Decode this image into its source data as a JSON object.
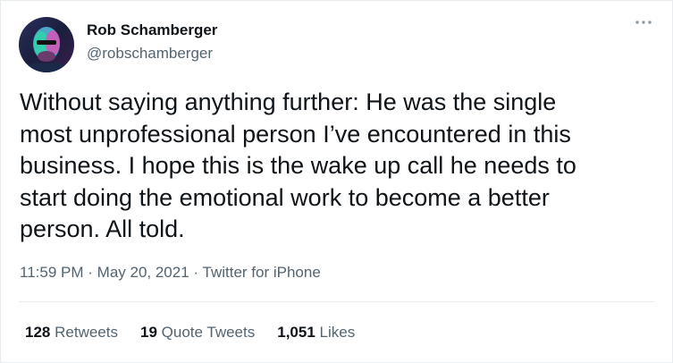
{
  "author": {
    "name": "Rob Schamberger",
    "handle": "@robschamberger"
  },
  "icons": {
    "avatar": "user-avatar",
    "more": "more-options-icon"
  },
  "tweet": {
    "text": "Without saying anything further: He was the single\nmost unprofessional person I’ve encountered in this\nbusiness. I hope this is the wake up call he needs to\nstart doing the emotional work to become a better\nperson. All told.",
    "time": "11:59 PM",
    "separator": "·",
    "date": "May 20, 2021",
    "source": "Twitter for iPhone"
  },
  "stats": {
    "retweets_count": "128",
    "retweets_label": "Retweets",
    "quotes_count": "19",
    "quotes_label": "Quote Tweets",
    "likes_count": "1,051",
    "likes_label": "Likes"
  },
  "colors": {
    "text_primary": "#0f1419",
    "text_secondary": "#536471",
    "border": "#e6ecf0"
  }
}
